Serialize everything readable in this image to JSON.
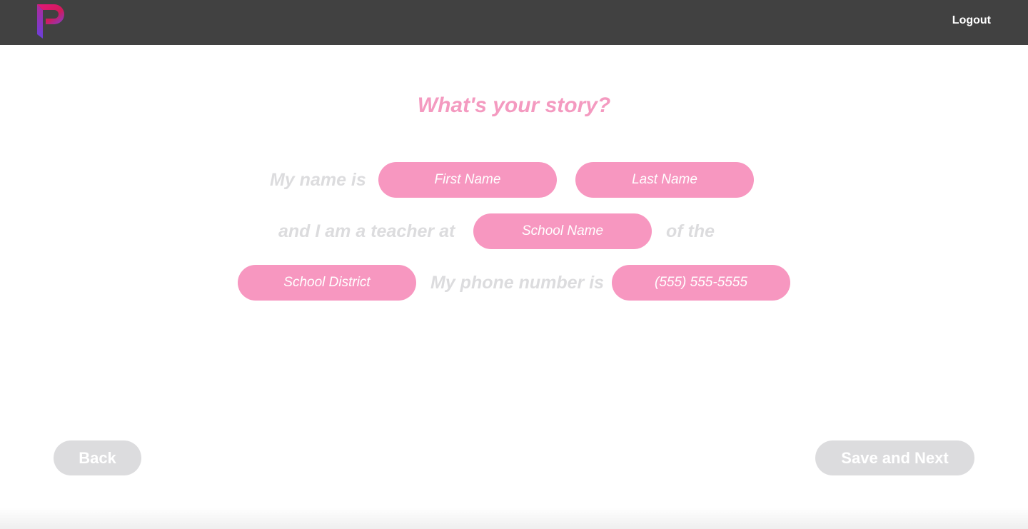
{
  "header": {
    "logout_label": "Logout",
    "logo_icon": "brand-p-logo-icon",
    "background_color": "#414141"
  },
  "main": {
    "title": "What's your story?",
    "sentence": {
      "my_name_is": "My name is",
      "and_i_am_teacher_at": "and I am a teacher at",
      "of_the": "of the",
      "my_phone_number_is": "My phone number is"
    },
    "fields": {
      "first_name": {
        "value": "",
        "placeholder": "First Name"
      },
      "last_name": {
        "value": "",
        "placeholder": "Last Name"
      },
      "school_name": {
        "value": "",
        "placeholder": "School Name"
      },
      "school_district": {
        "value": "",
        "placeholder": "School District"
      },
      "phone": {
        "value": "",
        "placeholder": "(555) 555-5555"
      }
    }
  },
  "footer": {
    "back_label": "Back",
    "save_next_label": "Save and Next"
  },
  "colors": {
    "accent_pink": "#f797c0",
    "title_pink": "#f49ac0",
    "muted_gray": "#dcdcde"
  }
}
